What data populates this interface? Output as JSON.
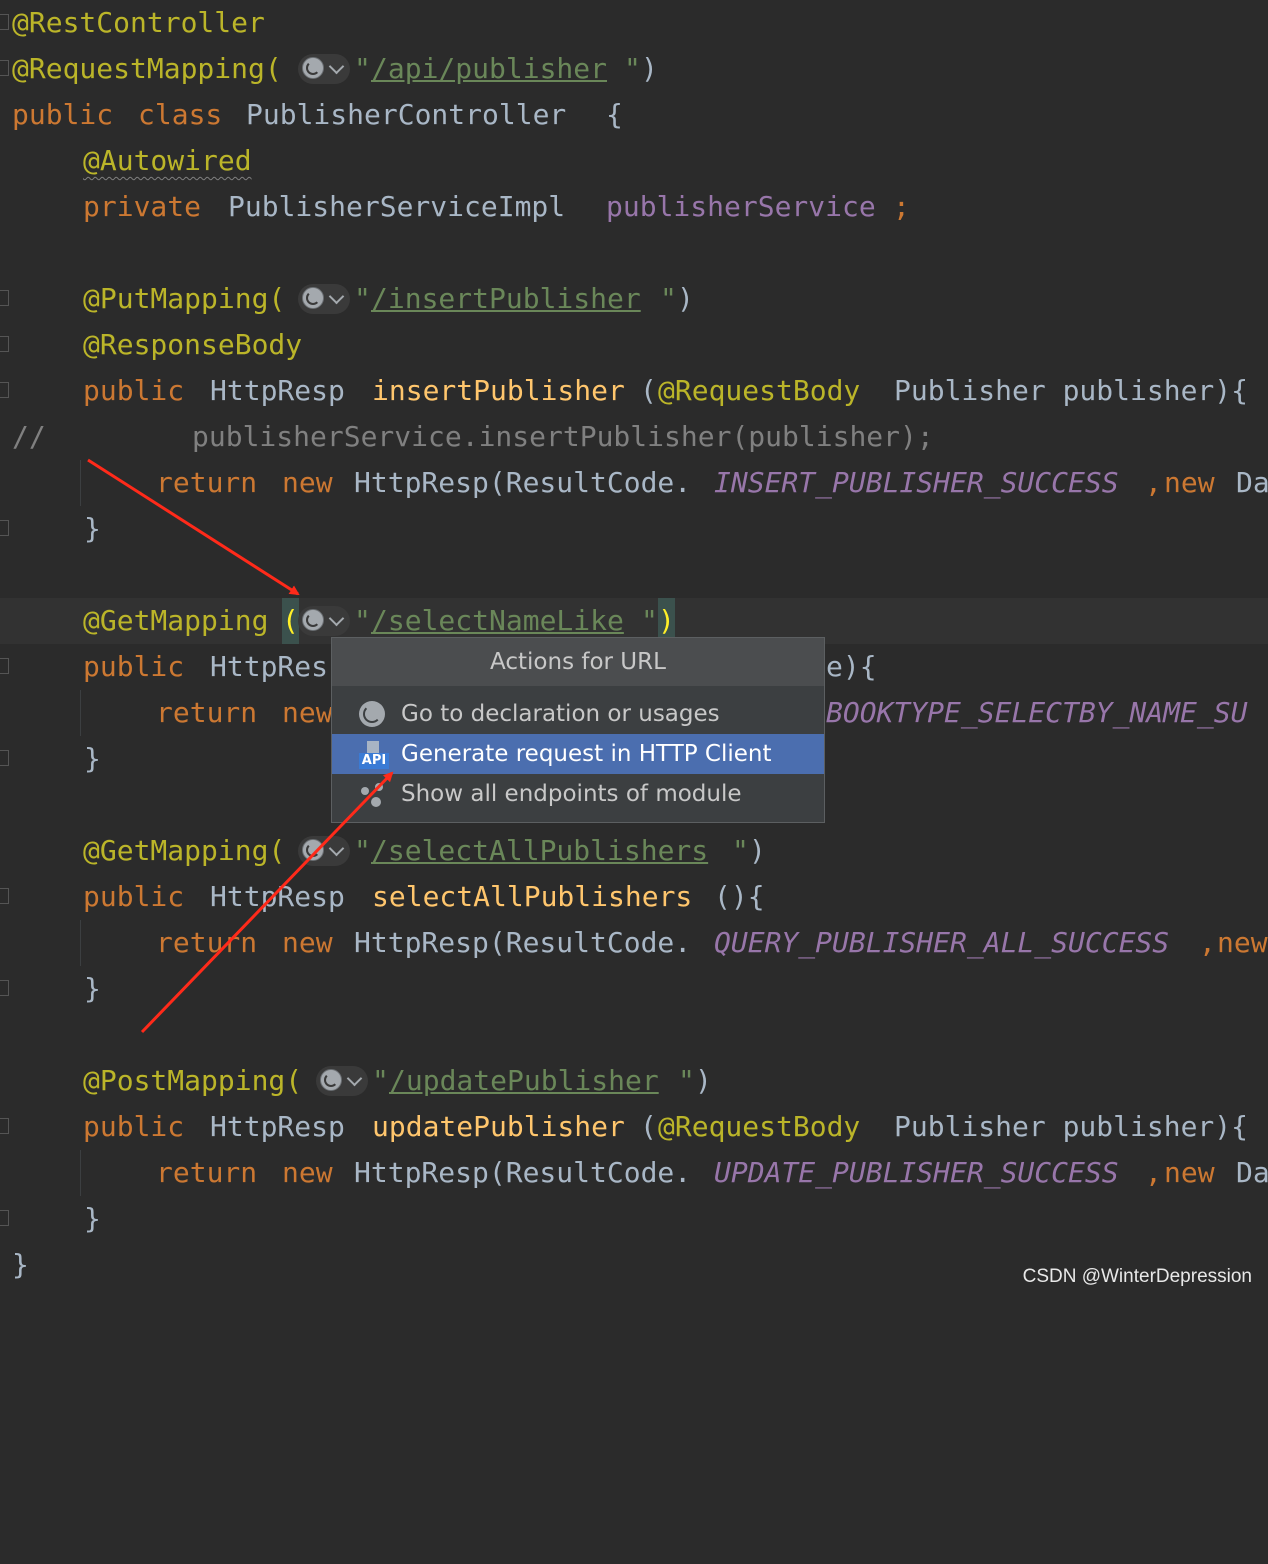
{
  "code": {
    "l1": {
      "ann": "@RestController"
    },
    "l2": {
      "ann": "@RequestMapping(",
      "q1": "\"",
      "url": "/api/publisher",
      "q2": "\"",
      "close": ")"
    },
    "l3": {
      "kw1": "public",
      "kw2": "class",
      "name": "PublisherController",
      "brace": "{"
    },
    "l4": {
      "ann": "@Autowired"
    },
    "l5": {
      "kw": "private",
      "type": "PublisherServiceImpl",
      "field": "publisherService",
      "semi": ";"
    },
    "l6": {
      "ann": "@PutMapping(",
      "q1": "\"",
      "url": "/insertPublisher",
      "q2": "\"",
      "close": ")"
    },
    "l7": {
      "ann": "@ResponseBody"
    },
    "l8": {
      "kw": "public",
      "type": "HttpResp",
      "method": "insertPublisher",
      "open": "(",
      "ann": "@RequestBody",
      "rest": "Publisher publisher){"
    },
    "l9": {
      "slashes": "//",
      "text": "publisherService.insertPublisher(publisher);"
    },
    "l10": {
      "kw": "return",
      "kw2": "new",
      "text": "HttpResp(ResultCode.",
      "const": "INSERT_PUBLISHER_SUCCESS",
      "comma": ",",
      "kw3": "new",
      "rest": "Da"
    },
    "l11": {
      "brace": "}"
    },
    "l12": {
      "ann": "@GetMapping",
      "paren": "(",
      "q1": "\"",
      "url": "/selectNameLike",
      "q2": "\"",
      "close": ")"
    },
    "l13": {
      "kw": "public",
      "type": "HttpRes",
      "tail": "e){"
    },
    "l14": {
      "kw": "return",
      "kw2": "new",
      "const": "BOOKTYPE_SELECTBY_NAME_SU"
    },
    "l15": {
      "brace": "}"
    },
    "l16": {
      "ann": "@GetMapping(",
      "q1": "\"",
      "url": "/selectAllPublishers",
      "q2": "\"",
      "close": ")"
    },
    "l17": {
      "kw": "public",
      "type": "HttpResp",
      "method": "selectAllPublishers",
      "rest": "(){"
    },
    "l18": {
      "kw": "return",
      "kw2": "new",
      "text": "HttpResp(ResultCode.",
      "const": "QUERY_PUBLISHER_ALL_SUCCESS",
      "comma": ",",
      "kw3": "new"
    },
    "l19": {
      "brace": "}"
    },
    "l20": {
      "ann": "@PostMapping(",
      "q1": "\"",
      "url": "/updatePublisher",
      "q2": "\"",
      "close": ")"
    },
    "l21": {
      "kw": "public",
      "type": "HttpResp",
      "method": "updatePublisher",
      "open": "(",
      "ann": "@RequestBody",
      "rest": "Publisher publisher){"
    },
    "l22": {
      "kw": "return",
      "kw2": "new",
      "text": "HttpResp(ResultCode.",
      "const": "UPDATE_PUBLISHER_SUCCESS",
      "comma": ",",
      "kw3": "new",
      "rest": "Da"
    },
    "l23": {
      "brace": "}"
    },
    "l24": {
      "brace": "}"
    }
  },
  "popup": {
    "title": "Actions for URL",
    "items": [
      {
        "label": "Go to declaration or usages",
        "icon": "globe-icon"
      },
      {
        "label": "Generate request in HTTP Client",
        "icon": "api-icon",
        "badge": "API"
      },
      {
        "label": "Show all endpoints of module",
        "icon": "endpoints-icon"
      }
    ],
    "selected_index": 1
  },
  "watermark": "CSDN @WinterDepression",
  "colors": {
    "background": "#2b2b2b",
    "keyword": "#cc7832",
    "annotation": "#bbb529",
    "method": "#ffc66d",
    "constant": "#9876aa",
    "string": "#6a8759",
    "selection": "#4b6eaf",
    "arrow": "#ff2a1a"
  }
}
